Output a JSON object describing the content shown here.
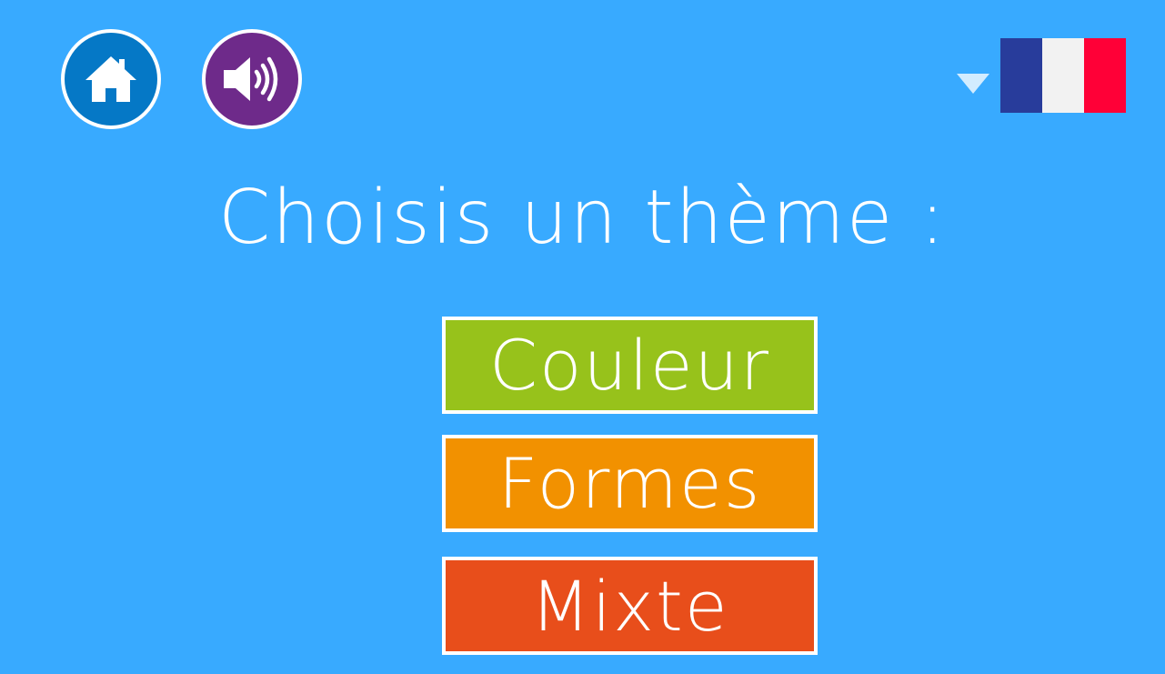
{
  "header": {
    "home_button": {
      "icon": "home-icon",
      "color": "#0578c6"
    },
    "sound_button": {
      "icon": "speaker-icon",
      "color": "#6e2a8a"
    },
    "language": {
      "caret_icon": "triangle-down-icon",
      "flag_icon": "france-flag-icon",
      "flag_colors": [
        "#283c9b",
        "#f2f2f2",
        "#ff0037"
      ]
    }
  },
  "main": {
    "title": "Choisis un thème :",
    "themes": [
      {
        "label": "Couleur",
        "color": "#97c21b"
      },
      {
        "label": "Formes",
        "color": "#f29100"
      },
      {
        "label": "Mixte",
        "color": "#e84e1b"
      }
    ]
  },
  "colors": {
    "background": "#38aaff",
    "text": "#ffffff"
  }
}
